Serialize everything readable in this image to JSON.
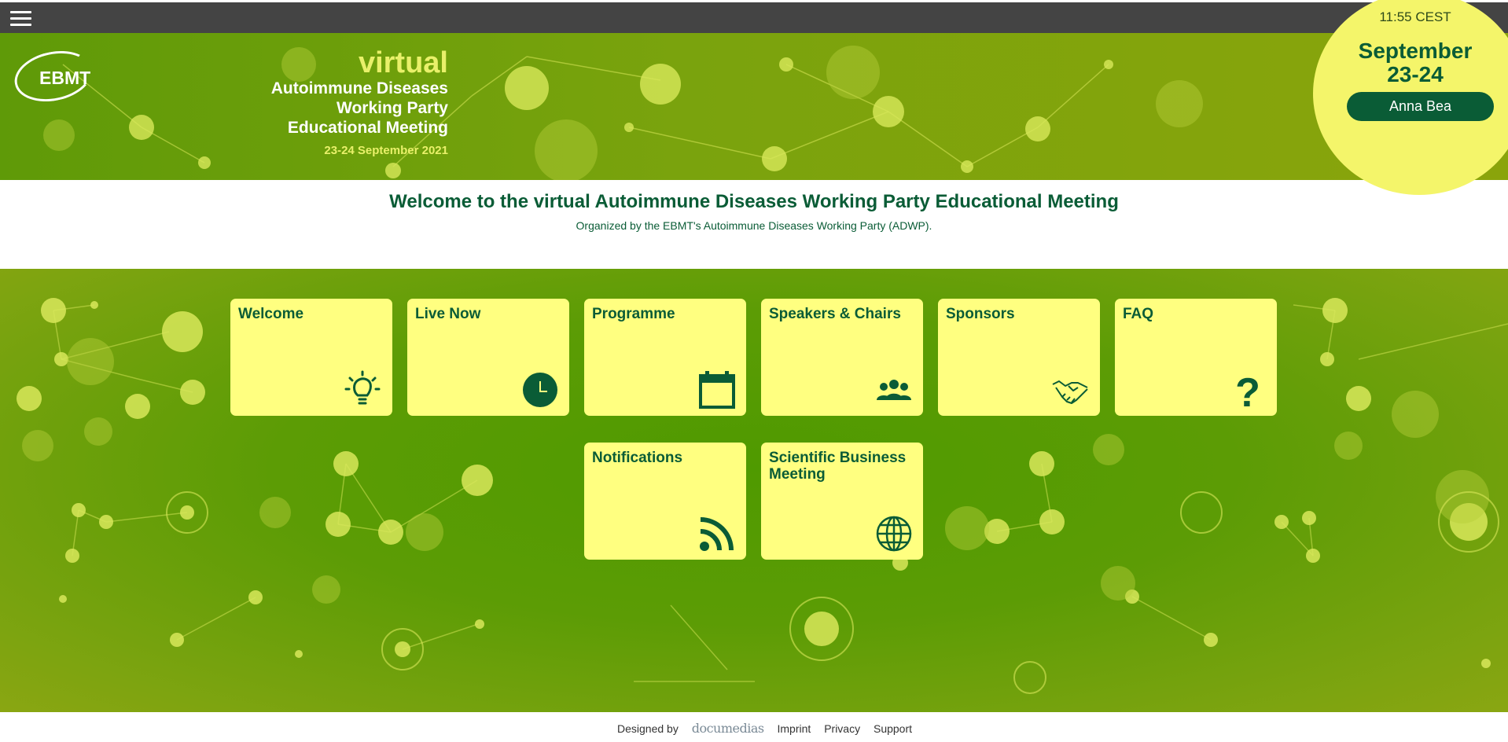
{
  "header": {
    "clock": "11:55 CEST",
    "date_line1": "September",
    "date_line2": "23-24",
    "user_name": "Anna Bea"
  },
  "banner": {
    "logo_text": "EBMT",
    "virtual": "virtual",
    "line1": "Autoimmune Diseases",
    "line2": "Working Party",
    "line3": "Educational Meeting",
    "dates": "23-24 September 2021"
  },
  "welcome": {
    "heading": "Welcome to the virtual Autoimmune Diseases Working Party Educational Meeting",
    "subheading": "Organized by the EBMT's Autoimmune Diseases Working Party (ADWP)."
  },
  "tiles": [
    {
      "label": "Welcome",
      "icon": "lightbulb-icon"
    },
    {
      "label": "Live Now",
      "icon": "clock-icon"
    },
    {
      "label": "Programme",
      "icon": "calendar-icon"
    },
    {
      "label": "Speakers & Chairs",
      "icon": "people-icon"
    },
    {
      "label": "Sponsors",
      "icon": "handshake-icon"
    },
    {
      "label": "FAQ",
      "icon": "question-icon"
    },
    {
      "label": "Notifications",
      "icon": "rss-icon"
    },
    {
      "label": "Scientific Business Meeting",
      "icon": "globe-icon"
    }
  ],
  "footer": {
    "designed_by": "Designed by",
    "brand": "documedias",
    "imprint": "Imprint",
    "privacy": "Privacy",
    "support": "Support"
  },
  "colors": {
    "accent_dark_green": "#0a5c36",
    "tile_yellow": "#ffff80",
    "circle_yellow": "#f4f56a",
    "topbar": "#444444"
  }
}
